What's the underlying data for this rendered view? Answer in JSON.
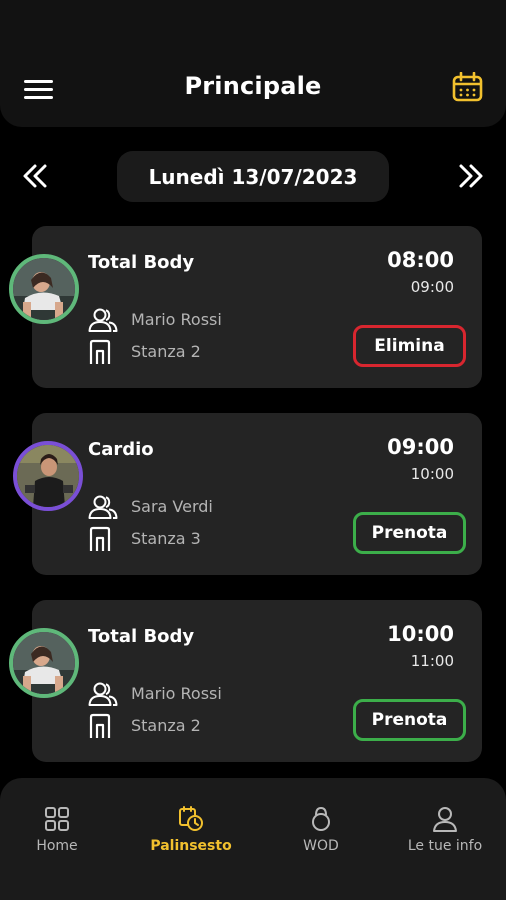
{
  "header": {
    "title": "Principale"
  },
  "date_nav": {
    "current_date": "Lunedì 13/07/2023"
  },
  "colors": {
    "accent": "#f2c12e",
    "book_border": "#3cae4a",
    "delete_border": "#d8262f",
    "card_bg": "#242424",
    "background": "#000000"
  },
  "classes": [
    {
      "title": "Total Body",
      "start": "08:00",
      "end": "09:00",
      "trainer": "Mario Rossi",
      "room": "Stanza 2",
      "action": "Elimina"
    },
    {
      "title": "Cardio",
      "start": "09:00",
      "end": "10:00",
      "trainer": "Sara Verdi",
      "room": "Stanza 3",
      "action": "Prenota"
    },
    {
      "title": "Total Body",
      "start": "10:00",
      "end": "11:00",
      "trainer": "Mario Rossi",
      "room": "Stanza 2",
      "action": "Prenota"
    }
  ],
  "bottom_nav": {
    "items": [
      {
        "label": "Home",
        "icon": "grid-icon"
      },
      {
        "label": "Palinsesto",
        "icon": "schedule-icon"
      },
      {
        "label": "WOD",
        "icon": "kettlebell-icon"
      },
      {
        "label": "Le tue info",
        "icon": "user-icon"
      }
    ],
    "active_index": 1
  }
}
